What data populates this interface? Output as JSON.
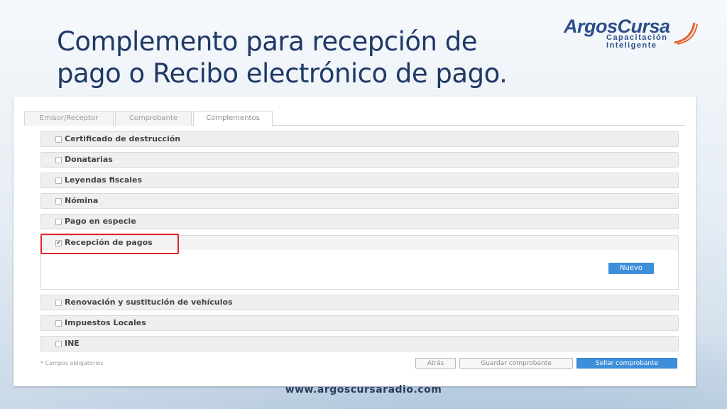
{
  "slide": {
    "title": "Complemento para recepción de pago o Recibo electrónico de pago.",
    "footer_url": "www.argoscursaradio.com"
  },
  "logo": {
    "name": "ArgosCursa",
    "tagline_line1": "Capacitación",
    "tagline_line2": "Inteligente"
  },
  "tabs": [
    {
      "label": "Emisor/Receptor",
      "active": false
    },
    {
      "label": "Comprobante",
      "active": false
    },
    {
      "label": "Complementos",
      "active": true
    }
  ],
  "complementos": [
    {
      "label": "Certificado de destrucción",
      "checked": false
    },
    {
      "label": "Donatarias",
      "checked": false
    },
    {
      "label": "Leyendas fiscales",
      "checked": false
    },
    {
      "label": "Nómina",
      "checked": false
    },
    {
      "label": "Pago en especie",
      "checked": false
    },
    {
      "label": "Recepción de pagos",
      "checked": true
    },
    {
      "label": "Renovación y sustitución de vehículos",
      "checked": false
    },
    {
      "label": "Impuestos Locales",
      "checked": false
    },
    {
      "label": "INE",
      "checked": false
    }
  ],
  "recepcion_panel": {
    "nuevo_label": "Nuevo"
  },
  "form_footer": {
    "note": "* Campos obligatorios",
    "atras_label": "Atrás",
    "guardar_label": "Guardar comprobante",
    "sellar_label": "Sellar comprobante"
  },
  "colors": {
    "title": "#1f3864",
    "primary_button": "#3d8fd9",
    "highlight": "#e0242c"
  }
}
